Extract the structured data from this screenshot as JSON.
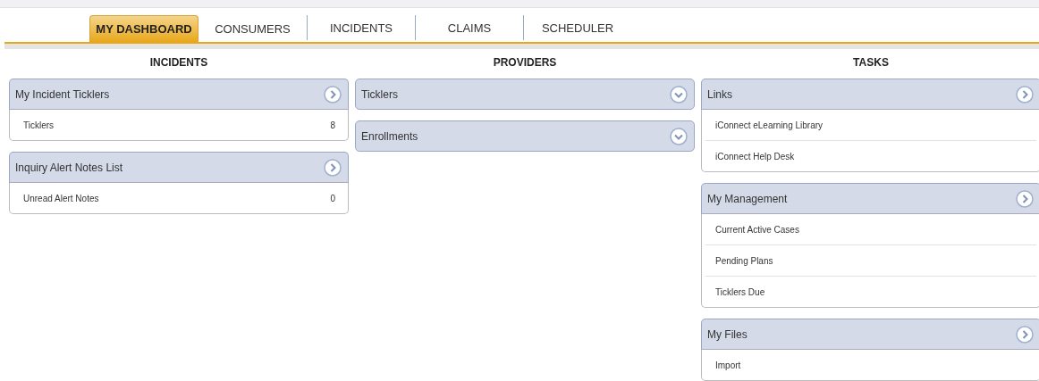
{
  "tabs": [
    {
      "label": "MY DASHBOARD",
      "selected": true
    },
    {
      "label": "CONSUMERS",
      "selected": false
    },
    {
      "label": "INCIDENTS",
      "selected": false
    },
    {
      "label": "CLAIMS",
      "selected": false
    },
    {
      "label": "SCHEDULER",
      "selected": false
    }
  ],
  "columns": [
    {
      "heading": "INCIDENTS",
      "panels": [
        {
          "title": "My Incident Ticklers",
          "expanded": true,
          "items": [
            {
              "label": "Ticklers",
              "count": "8"
            }
          ]
        },
        {
          "title": "Inquiry Alert Notes List",
          "expanded": true,
          "items": [
            {
              "label": "Unread Alert Notes",
              "count": "0"
            }
          ]
        }
      ]
    },
    {
      "heading": "PROVIDERS",
      "panels": [
        {
          "title": "Ticklers",
          "expanded": false
        },
        {
          "title": "Enrollments",
          "expanded": false
        }
      ]
    },
    {
      "heading": "TASKS",
      "panels": [
        {
          "title": "Links",
          "expanded": true,
          "items": [
            {
              "label": "iConnect eLearning Library"
            },
            {
              "label": "iConnect Help Desk"
            }
          ]
        },
        {
          "title": "My Management",
          "expanded": true,
          "items": [
            {
              "label": "Current Active Cases"
            },
            {
              "label": "Pending Plans"
            },
            {
              "label": "Ticklers Due"
            }
          ]
        },
        {
          "title": "My Files",
          "expanded": true,
          "items": [
            {
              "label": "Import"
            }
          ]
        }
      ]
    }
  ]
}
